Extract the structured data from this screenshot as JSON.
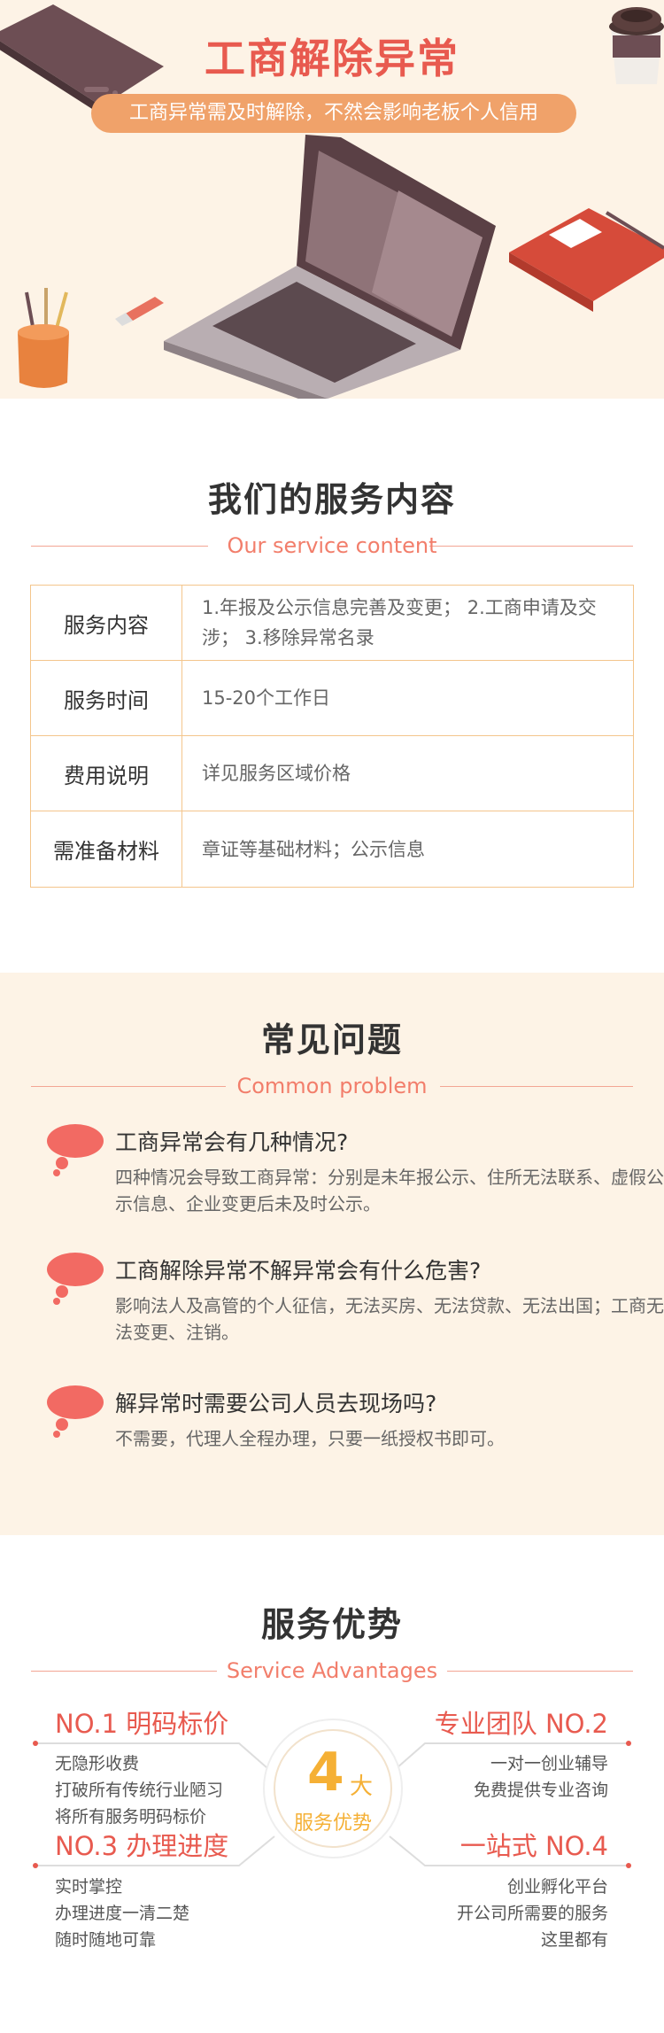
{
  "hero": {
    "title": "工商解除异常",
    "subtitle": "工商异常需及时解除，不然会影响老板个人信用"
  },
  "service": {
    "title": "我们的服务内容",
    "subtitle": "Our service content",
    "rows": [
      {
        "label": "服务内容",
        "value": "1.年报及公示信息完善及变更； 2.工商申请及交涉； 3.移除异常名录"
      },
      {
        "label": "服务时间",
        "value": "15-20个工作日"
      },
      {
        "label": "费用说明",
        "value": "详见服务区域价格"
      },
      {
        "label": "需准备材料",
        "value": "章证等基础材料；公示信息"
      }
    ]
  },
  "faq": {
    "title": "常见问题",
    "subtitle": "Common problem",
    "items": [
      {
        "q": "工商异常会有几种情况?",
        "a": "四种情况会导致工商异常：分别是未年报公示、住所无法联系、虚假公示信息、企业变更后未及时公示。"
      },
      {
        "q": "工商解除异常不解异常会有什么危害?",
        "a": "影响法人及高管的个人征信，无法买房、无法贷款、无法出国；工商无法变更、注销。"
      },
      {
        "q": "解异常时需要公司人员去现场吗?",
        "a": "不需要，代理人全程办理，只要一纸授权书即可。"
      }
    ]
  },
  "advantages": {
    "title": "服务优势",
    "subtitle": "Service Advantages",
    "center_number": "4",
    "center_unit": "大",
    "center_label": "服务优势",
    "items": [
      {
        "title": "NO.1 明码标价",
        "lines": [
          "无隐形收费",
          "打破所有传统行业陋习",
          "将所有服务明码标价"
        ]
      },
      {
        "title": "专业团队 NO.2",
        "lines": [
          "一对一创业辅导",
          "免费提供专业咨询"
        ]
      },
      {
        "title": "NO.3 办理进度",
        "lines": [
          "实时掌控",
          "办理进度一清二楚",
          "随时随地可靠"
        ]
      },
      {
        "title": "一站式 NO.4",
        "lines": [
          "创业孵化平台",
          "开公司所需要的服务",
          "这里都有"
        ]
      }
    ]
  },
  "colors": {
    "accent": "#e85a4f",
    "pill": "#f0a26a",
    "cream": "#fdf3e6",
    "table_border": "#f4c58c",
    "gold": "#f5b035"
  }
}
